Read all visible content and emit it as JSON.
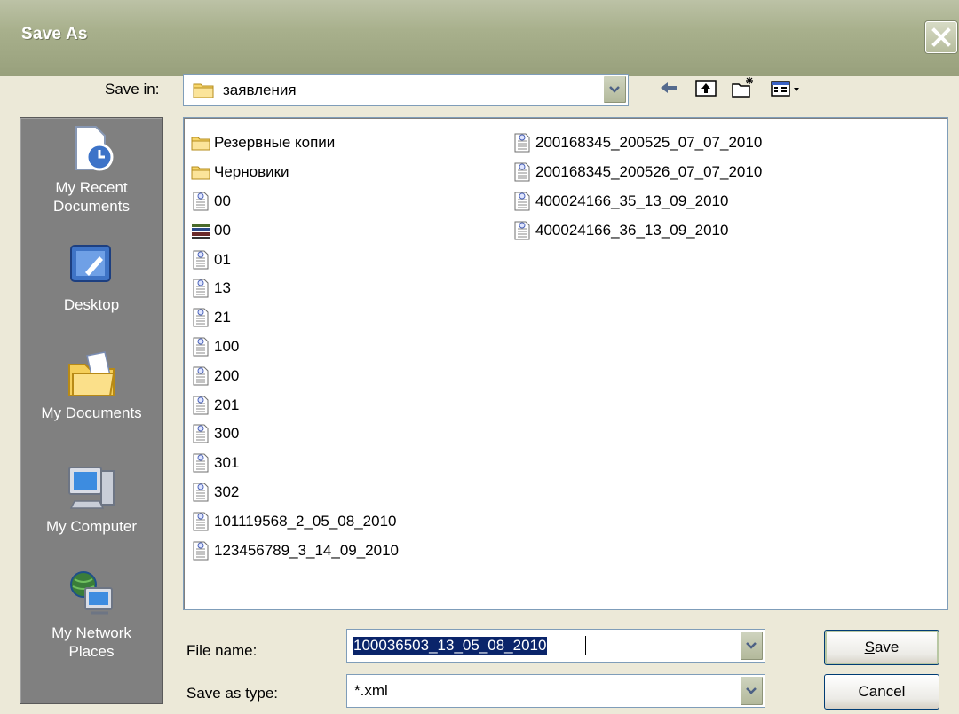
{
  "window": {
    "title": "Save As"
  },
  "save_in": {
    "label": "Save in:",
    "value": "заявления"
  },
  "toolbar": {
    "back_icon": "back-arrow-icon",
    "up_icon": "up-folder-icon",
    "new_folder_icon": "new-folder-icon",
    "views_icon": "views-menu-icon"
  },
  "places": [
    {
      "label_lines": [
        "My Recent",
        "Documents"
      ],
      "icon": "recent-documents-icon"
    },
    {
      "label_lines": [
        "Desktop"
      ],
      "icon": "desktop-icon"
    },
    {
      "label_lines": [
        "My Documents"
      ],
      "icon": "my-documents-icon"
    },
    {
      "label_lines": [
        "My Computer"
      ],
      "icon": "my-computer-icon"
    },
    {
      "label_lines": [
        "My Network",
        "Places"
      ],
      "icon": "network-places-icon"
    }
  ],
  "files_col1": [
    {
      "name": "Резервные копии",
      "type": "folder"
    },
    {
      "name": "Черновики",
      "type": "folder"
    },
    {
      "name": "00",
      "type": "doc"
    },
    {
      "name": "00",
      "type": "archive"
    },
    {
      "name": "01",
      "type": "doc"
    },
    {
      "name": "13",
      "type": "doc"
    },
    {
      "name": "21",
      "type": "doc"
    },
    {
      "name": "100",
      "type": "doc"
    },
    {
      "name": "200",
      "type": "doc"
    },
    {
      "name": "201",
      "type": "doc"
    },
    {
      "name": "300",
      "type": "doc"
    },
    {
      "name": "301",
      "type": "doc"
    },
    {
      "name": "302",
      "type": "doc"
    },
    {
      "name": "101119568_2_05_08_2010",
      "type": "doc"
    },
    {
      "name": "123456789_3_14_09_2010",
      "type": "doc"
    }
  ],
  "files_col2": [
    {
      "name": "200168345_200525_07_07_2010",
      "type": "doc"
    },
    {
      "name": "200168345_200526_07_07_2010",
      "type": "doc"
    },
    {
      "name": "400024166_35_13_09_2010",
      "type": "doc"
    },
    {
      "name": "400024166_36_13_09_2010",
      "type": "doc"
    }
  ],
  "file_name": {
    "label": "File name:",
    "value": "100036503_13_05_08_2010"
  },
  "save_type": {
    "label": "Save as type:",
    "value": "*.xml"
  },
  "buttons": {
    "save_accel": "S",
    "save_rest": "ave",
    "cancel": "Cancel"
  },
  "colors": {
    "selection": "#0a246a",
    "places_bg": "#808080",
    "titlebar": "#a8b08c"
  }
}
